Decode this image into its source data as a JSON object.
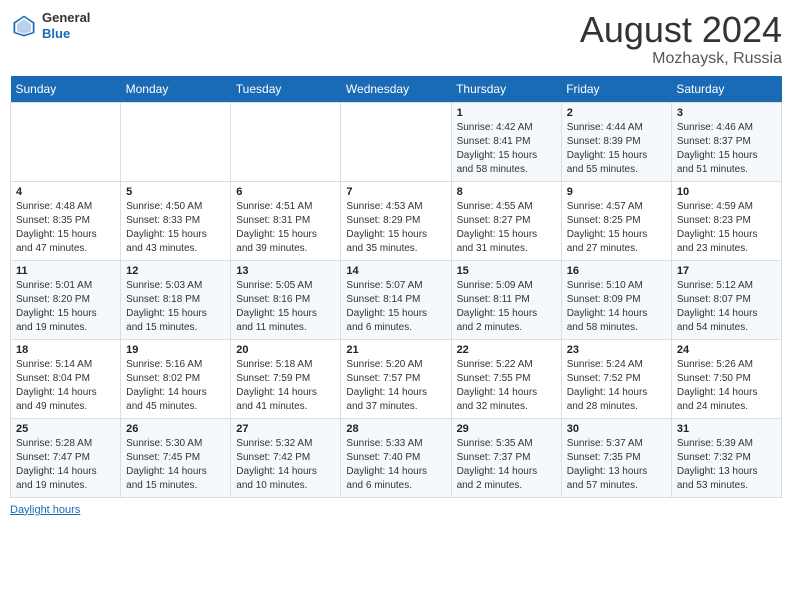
{
  "header": {
    "logo_line1": "General",
    "logo_line2": "Blue",
    "month_year": "August 2024",
    "location": "Mozhaysk, Russia"
  },
  "days_of_week": [
    "Sunday",
    "Monday",
    "Tuesday",
    "Wednesday",
    "Thursday",
    "Friday",
    "Saturday"
  ],
  "weeks": [
    {
      "cells": [
        {
          "day": null,
          "info": null
        },
        {
          "day": null,
          "info": null
        },
        {
          "day": null,
          "info": null
        },
        {
          "day": null,
          "info": null
        },
        {
          "day": "1",
          "info": "Sunrise: 4:42 AM\nSunset: 8:41 PM\nDaylight: 15 hours\nand 58 minutes."
        },
        {
          "day": "2",
          "info": "Sunrise: 4:44 AM\nSunset: 8:39 PM\nDaylight: 15 hours\nand 55 minutes."
        },
        {
          "day": "3",
          "info": "Sunrise: 4:46 AM\nSunset: 8:37 PM\nDaylight: 15 hours\nand 51 minutes."
        }
      ]
    },
    {
      "cells": [
        {
          "day": "4",
          "info": "Sunrise: 4:48 AM\nSunset: 8:35 PM\nDaylight: 15 hours\nand 47 minutes."
        },
        {
          "day": "5",
          "info": "Sunrise: 4:50 AM\nSunset: 8:33 PM\nDaylight: 15 hours\nand 43 minutes."
        },
        {
          "day": "6",
          "info": "Sunrise: 4:51 AM\nSunset: 8:31 PM\nDaylight: 15 hours\nand 39 minutes."
        },
        {
          "day": "7",
          "info": "Sunrise: 4:53 AM\nSunset: 8:29 PM\nDaylight: 15 hours\nand 35 minutes."
        },
        {
          "day": "8",
          "info": "Sunrise: 4:55 AM\nSunset: 8:27 PM\nDaylight: 15 hours\nand 31 minutes."
        },
        {
          "day": "9",
          "info": "Sunrise: 4:57 AM\nSunset: 8:25 PM\nDaylight: 15 hours\nand 27 minutes."
        },
        {
          "day": "10",
          "info": "Sunrise: 4:59 AM\nSunset: 8:23 PM\nDaylight: 15 hours\nand 23 minutes."
        }
      ]
    },
    {
      "cells": [
        {
          "day": "11",
          "info": "Sunrise: 5:01 AM\nSunset: 8:20 PM\nDaylight: 15 hours\nand 19 minutes."
        },
        {
          "day": "12",
          "info": "Sunrise: 5:03 AM\nSunset: 8:18 PM\nDaylight: 15 hours\nand 15 minutes."
        },
        {
          "day": "13",
          "info": "Sunrise: 5:05 AM\nSunset: 8:16 PM\nDaylight: 15 hours\nand 11 minutes."
        },
        {
          "day": "14",
          "info": "Sunrise: 5:07 AM\nSunset: 8:14 PM\nDaylight: 15 hours\nand 6 minutes."
        },
        {
          "day": "15",
          "info": "Sunrise: 5:09 AM\nSunset: 8:11 PM\nDaylight: 15 hours\nand 2 minutes."
        },
        {
          "day": "16",
          "info": "Sunrise: 5:10 AM\nSunset: 8:09 PM\nDaylight: 14 hours\nand 58 minutes."
        },
        {
          "day": "17",
          "info": "Sunrise: 5:12 AM\nSunset: 8:07 PM\nDaylight: 14 hours\nand 54 minutes."
        }
      ]
    },
    {
      "cells": [
        {
          "day": "18",
          "info": "Sunrise: 5:14 AM\nSunset: 8:04 PM\nDaylight: 14 hours\nand 49 minutes."
        },
        {
          "day": "19",
          "info": "Sunrise: 5:16 AM\nSunset: 8:02 PM\nDaylight: 14 hours\nand 45 minutes."
        },
        {
          "day": "20",
          "info": "Sunrise: 5:18 AM\nSunset: 7:59 PM\nDaylight: 14 hours\nand 41 minutes."
        },
        {
          "day": "21",
          "info": "Sunrise: 5:20 AM\nSunset: 7:57 PM\nDaylight: 14 hours\nand 37 minutes."
        },
        {
          "day": "22",
          "info": "Sunrise: 5:22 AM\nSunset: 7:55 PM\nDaylight: 14 hours\nand 32 minutes."
        },
        {
          "day": "23",
          "info": "Sunrise: 5:24 AM\nSunset: 7:52 PM\nDaylight: 14 hours\nand 28 minutes."
        },
        {
          "day": "24",
          "info": "Sunrise: 5:26 AM\nSunset: 7:50 PM\nDaylight: 14 hours\nand 24 minutes."
        }
      ]
    },
    {
      "cells": [
        {
          "day": "25",
          "info": "Sunrise: 5:28 AM\nSunset: 7:47 PM\nDaylight: 14 hours\nand 19 minutes."
        },
        {
          "day": "26",
          "info": "Sunrise: 5:30 AM\nSunset: 7:45 PM\nDaylight: 14 hours\nand 15 minutes."
        },
        {
          "day": "27",
          "info": "Sunrise: 5:32 AM\nSunset: 7:42 PM\nDaylight: 14 hours\nand 10 minutes."
        },
        {
          "day": "28",
          "info": "Sunrise: 5:33 AM\nSunset: 7:40 PM\nDaylight: 14 hours\nand 6 minutes."
        },
        {
          "day": "29",
          "info": "Sunrise: 5:35 AM\nSunset: 7:37 PM\nDaylight: 14 hours\nand 2 minutes."
        },
        {
          "day": "30",
          "info": "Sunrise: 5:37 AM\nSunset: 7:35 PM\nDaylight: 13 hours\nand 57 minutes."
        },
        {
          "day": "31",
          "info": "Sunrise: 5:39 AM\nSunset: 7:32 PM\nDaylight: 13 hours\nand 53 minutes."
        }
      ]
    }
  ],
  "footer": {
    "daylight_hours_label": "Daylight hours"
  }
}
